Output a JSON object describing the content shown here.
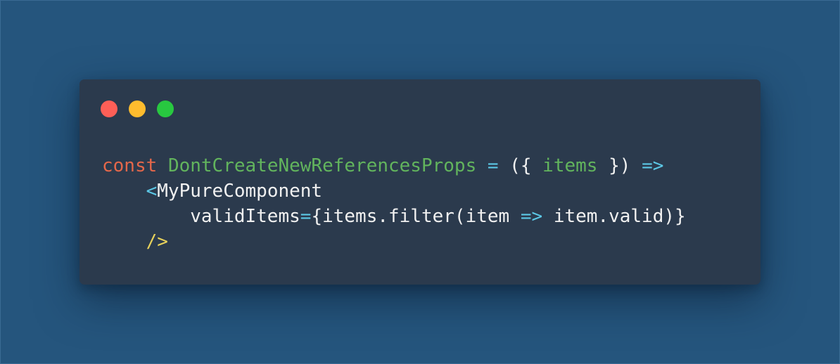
{
  "window": {
    "controls": [
      {
        "name": "close",
        "color": "#fe5f57"
      },
      {
        "name": "minimize",
        "color": "#febc2e"
      },
      {
        "name": "zoom",
        "color": "#28c840"
      }
    ]
  },
  "code": {
    "line1": {
      "keyword": "const",
      "name": "DontCreateNewReferencesProps",
      "assign": "=",
      "open": "({",
      "param": "items",
      "close": "})",
      "arrow": "=>"
    },
    "line2": {
      "bracket": "<",
      "tag": "MyPureComponent"
    },
    "line3": {
      "attr": "validItems",
      "eq": "=",
      "expr1": "{items.filter(item",
      "arrow": "=>",
      "expr2": "item.valid)}"
    },
    "line4": {
      "selfclose": "/>"
    }
  },
  "colors": {
    "background": "#25557d",
    "window": "#2b3a4d",
    "keyword": "#e4674a",
    "identifier": "#62b45d",
    "operator": "#5cc8e6",
    "text": "#f0f0f0",
    "jsx_close": "#e8d25b"
  }
}
